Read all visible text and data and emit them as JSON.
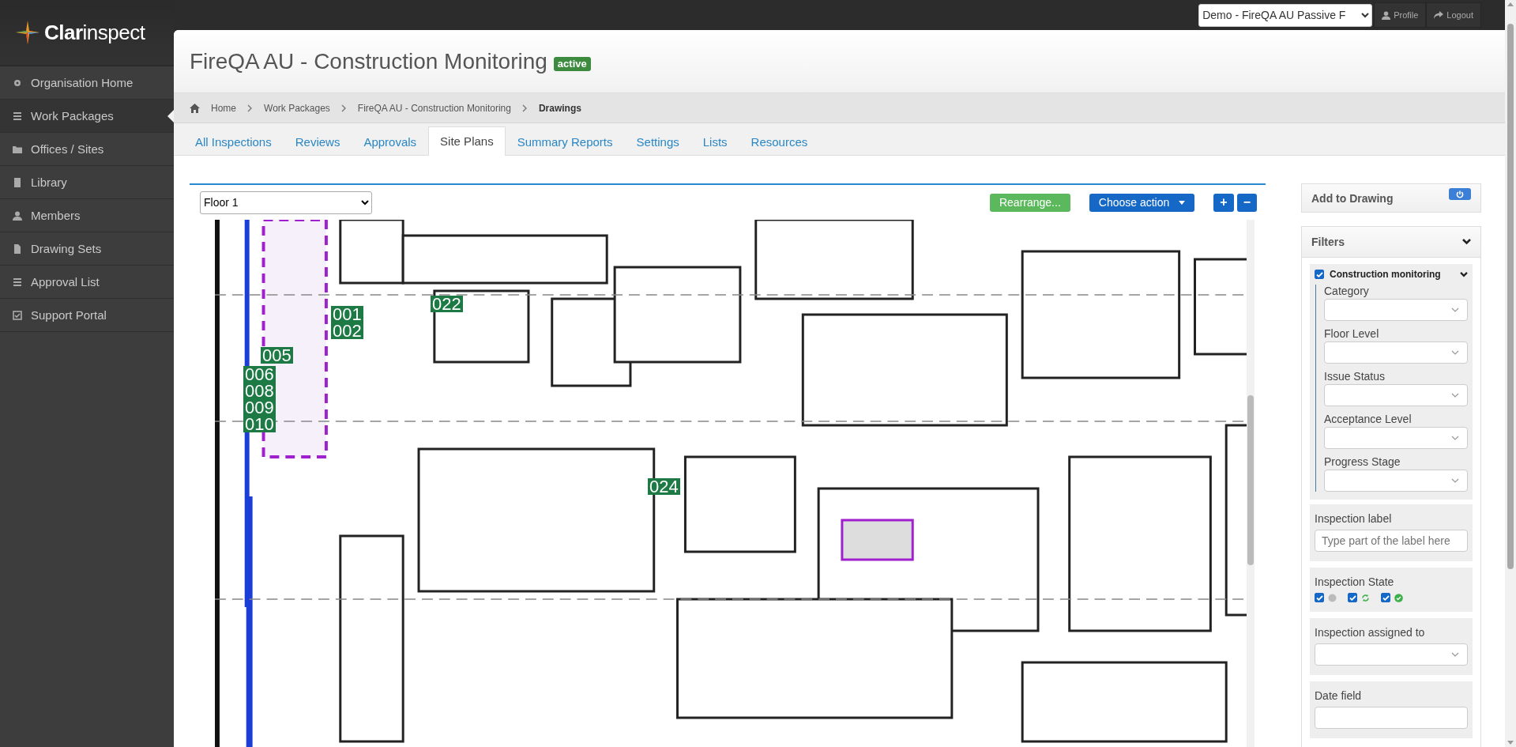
{
  "app": {
    "logo_bold": "Clar",
    "logo_light": "inspect"
  },
  "account_select": {
    "value": "Demo - FireQA AU Passive F"
  },
  "header_buttons": [
    {
      "label": "Profile",
      "kind": "user"
    },
    {
      "label": "Logout",
      "kind": "share"
    }
  ],
  "sidebar": {
    "items": [
      {
        "label": "Organisation Home",
        "kind": "gear",
        "selected": false
      },
      {
        "label": "Work Packages",
        "kind": "list",
        "selected": true
      },
      {
        "label": "Offices / Sites",
        "kind": "folder",
        "selected": false
      },
      {
        "label": "Library",
        "kind": "book",
        "selected": false
      },
      {
        "label": "Members",
        "kind": "user",
        "selected": false
      },
      {
        "label": "Drawing Sets",
        "kind": "file",
        "selected": false
      },
      {
        "label": "Approval List",
        "kind": "list",
        "selected": false
      },
      {
        "label": "Support Portal",
        "kind": "check",
        "selected": false
      }
    ]
  },
  "page": {
    "title": "FireQA AU - Construction Monitoring",
    "badge": "active"
  },
  "breadcrumb": [
    "Home",
    "Work Packages",
    "FireQA AU - Construction Monitoring",
    "Drawings"
  ],
  "tabs": [
    {
      "label": "All Inspections",
      "selected": false
    },
    {
      "label": "Reviews",
      "selected": false
    },
    {
      "label": "Approvals",
      "selected": false
    },
    {
      "label": "Site Plans",
      "selected": true
    },
    {
      "label": "Summary Reports",
      "selected": false
    },
    {
      "label": "Settings",
      "selected": false
    },
    {
      "label": "Lists",
      "selected": false
    },
    {
      "label": "Resources",
      "selected": false
    }
  ],
  "toolbar": {
    "floor_select": "Floor 1",
    "rearrange_button": "Rearrange...",
    "action_button": "Choose action",
    "zoom_in": "+",
    "zoom_out": "−"
  },
  "markers": [
    {
      "labels": [
        "001",
        "002"
      ]
    },
    {
      "labels": [
        "005"
      ]
    },
    {
      "labels": [
        "006",
        "008",
        "009",
        "010"
      ]
    },
    {
      "labels": [
        "022"
      ]
    },
    {
      "labels": [
        "024"
      ]
    }
  ],
  "add_to_drawing": {
    "title": "Add to Drawing"
  },
  "filters": {
    "title": "Filters",
    "group": {
      "label": "Construction monitoring",
      "checked": true,
      "fields": [
        "Category",
        "Floor Level",
        "Issue Status",
        "Acceptance Level",
        "Progress Stage"
      ]
    },
    "inspection_label": {
      "label": "Inspection label",
      "placeholder": "Type part of the label here"
    },
    "inspection_state": {
      "label": "Inspection State",
      "options": [
        {
          "kind": "not_started",
          "checked": true
        },
        {
          "kind": "in_progress",
          "checked": true
        },
        {
          "kind": "complete",
          "checked": true
        }
      ]
    },
    "assigned_to": {
      "label": "Inspection assigned to"
    },
    "date_field": {
      "label": "Date field"
    }
  }
}
